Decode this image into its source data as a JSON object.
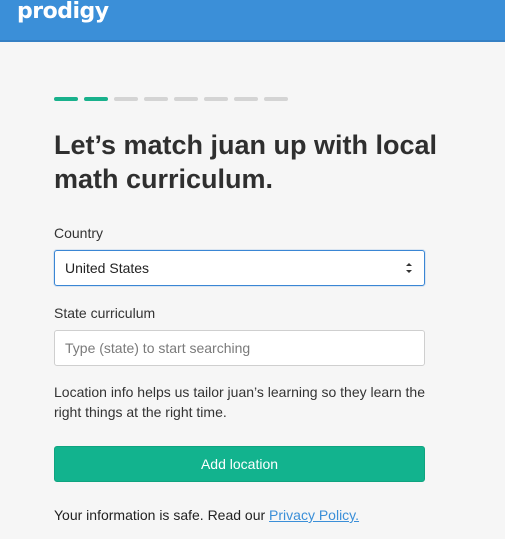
{
  "header": {
    "logo": "prodigy",
    "background_color": "#3b8fd8"
  },
  "progress": {
    "total_steps": 8,
    "completed_steps": 2,
    "active_color": "#19b18c",
    "inactive_color": "#d4d4d4"
  },
  "main": {
    "title": "Let’s match juan up with local math curriculum.",
    "country": {
      "label": "Country",
      "selected_value": "United States",
      "icon": "select-arrows-icon"
    },
    "state": {
      "label": "State curriculum",
      "value": "",
      "placeholder": "Type (state) to start searching"
    },
    "help_text": "Location info helps us tailor juan’s learning so they learn the right things at the right time.",
    "submit_label": "Add location",
    "submit_color": "#12b38e",
    "footer": {
      "text": "Your information is safe. Read our ",
      "link_label": "Privacy Policy."
    }
  }
}
